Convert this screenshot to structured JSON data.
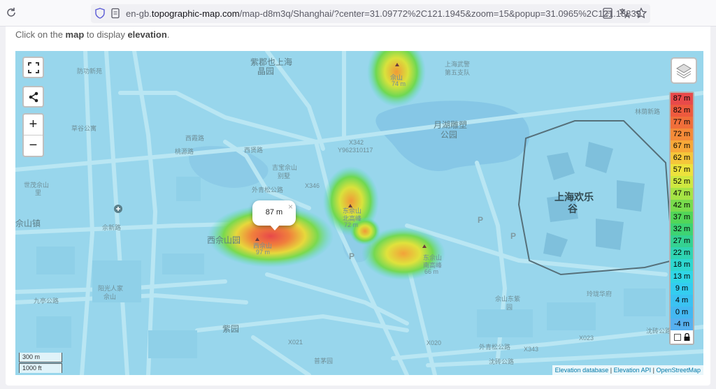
{
  "browser": {
    "url_prefix": "en-gb.",
    "url_domain": "topographic-map.com",
    "url_path": "/map-d8m3q/Shanghai/?center=31.09772%2C121.1945&zoom=15&popup=31.0965%2C121.18839"
  },
  "page": {
    "hint_pre": "Click on the ",
    "hint_map": "map",
    "hint_mid": " to display ",
    "hint_elevation": "elevation",
    "hint_post": "."
  },
  "map": {
    "popup": {
      "text": "87 m",
      "close": "×"
    },
    "scale": {
      "metric": "300 m",
      "imperial": "1000 ft"
    },
    "attribution": {
      "link1": "Elevation database",
      "sep1": " | ",
      "link2": "Elevation API",
      "sep2": " | ",
      "link3": "OpenStreetMap"
    },
    "controls": {
      "zoom_in": "+",
      "zoom_out": "−"
    },
    "labels": {
      "l1": "紫郡也上海",
      "l2": "晶园",
      "l3": "防功新苑",
      "l4": "佘山",
      "l5": "74 m",
      "l6": "上海武警",
      "l7": "第五支队",
      "l8": "月湖雕塑",
      "l9": "公园",
      "l10": "林荫新路",
      "l11": "西霞路",
      "l12": "草谷公寓",
      "l13": "桃源路",
      "l14": "西贤路",
      "l15": "X342",
      "l16": "Y962310117",
      "l17": "吉宝佘山",
      "l18": "别墅",
      "l19": "世茂佘山",
      "l20": "里",
      "l21": "外青松公路",
      "l22": "X346",
      "l23": "佘山镇",
      "l24": "佘新路",
      "l25": "西佘山园",
      "l26": "西佘山",
      "l27": "97 m",
      "l28": "东佘山",
      "l29": "北高峰",
      "l30": "72 m",
      "l31": "东佘山",
      "l32": "南高峰",
      "l33": "66 m",
      "l34": "上海欢乐",
      "l35": "谷",
      "l36": "阳光人家",
      "l37": "佘山",
      "l38": "九亭公路",
      "l39": "紫园",
      "l40": "佘山东紫",
      "l41": "园",
      "l42": "玲珑华府",
      "l43": "X021",
      "l44": "X020",
      "l45": "X343",
      "l46": "X023",
      "l47": "外青松公路",
      "l48": "沈砖公路",
      "l49": "沈砖公路",
      "l50": "普茅园",
      "l51": "P",
      "l52": "P",
      "l53": "P"
    }
  },
  "legend": {
    "rows": [
      {
        "label": "87 m",
        "color": "#e84a4a"
      },
      {
        "label": "82 m",
        "color": "#ee5a3e"
      },
      {
        "label": "77 m",
        "color": "#f06e3a"
      },
      {
        "label": "72 m",
        "color": "#f48a38"
      },
      {
        "label": "67 m",
        "color": "#f7a838"
      },
      {
        "label": "62 m",
        "color": "#f5c63a"
      },
      {
        "label": "57 m",
        "color": "#ede23c"
      },
      {
        "label": "52 m",
        "color": "#cfe840"
      },
      {
        "label": "47 m",
        "color": "#a6e445"
      },
      {
        "label": "42 m",
        "color": "#78dc4c"
      },
      {
        "label": "37 m",
        "color": "#52d658"
      },
      {
        "label": "32 m",
        "color": "#3ed372"
      },
      {
        "label": "27 m",
        "color": "#34d292"
      },
      {
        "label": "22 m",
        "color": "#30d4b2"
      },
      {
        "label": "18 m",
        "color": "#2ed7cf"
      },
      {
        "label": "13 m",
        "color": "#30d6e6"
      },
      {
        "label": "9 m",
        "color": "#34cdf0"
      },
      {
        "label": "4 m",
        "color": "#3bc2f2"
      },
      {
        "label": "0 m",
        "color": "#44b8f2"
      },
      {
        "label": "-4 m",
        "color": "#56b0ef"
      }
    ]
  },
  "colors": {
    "accent": "#0078a8",
    "water": "#9fd9ee"
  }
}
